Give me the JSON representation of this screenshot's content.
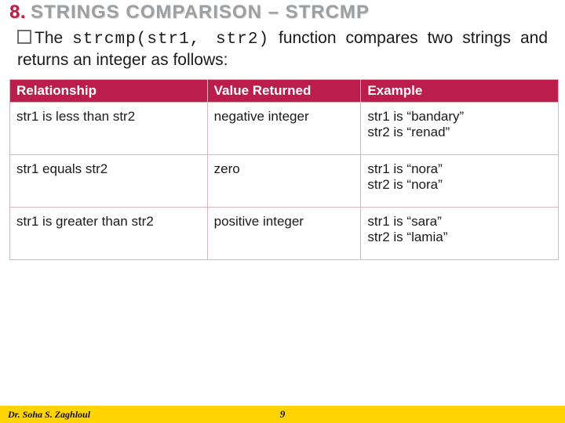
{
  "title": {
    "number": "8.",
    "text": "STRINGS COMPARISON – STRCMP"
  },
  "description": {
    "prefix": "The ",
    "code": "strcmp(str1, str2)",
    "suffix": " function compares two strings and returns an integer as follows:"
  },
  "table": {
    "headers": [
      "Relationship",
      "Value Returned",
      "Example"
    ],
    "rows": [
      {
        "rel": "str1 is less than str2",
        "val": "negative integer",
        "ex_l1": "str1 is “bandary”",
        "ex_l2": "str2 is “renad”"
      },
      {
        "rel": "str1 equals str2",
        "val": "zero",
        "ex_l1": "str1 is “nora”",
        "ex_l2": "str2 is “nora”"
      },
      {
        "rel": "str1 is greater than str2",
        "val": "positive integer",
        "ex_l1": "str1 is “sara”",
        "ex_l2": "str2 is “lamia”"
      }
    ]
  },
  "footer": {
    "author": "Dr. Soha S. Zaghloul",
    "page": "9"
  }
}
